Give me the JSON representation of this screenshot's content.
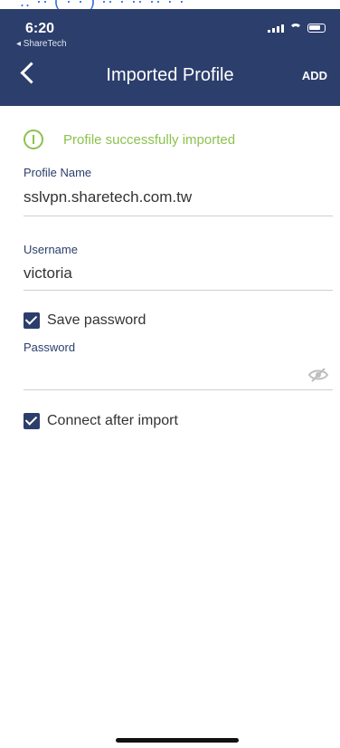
{
  "app": {
    "name": "ShareTech"
  },
  "status_bar": {
    "time": "6:20",
    "back_app": "◂ ShareTech"
  },
  "header": {
    "title": "Imported Profile",
    "action_label": "ADD"
  },
  "banner": {
    "message": "Profile successfully imported"
  },
  "form": {
    "profile_name": {
      "label": "Profile Name",
      "value": "sslvpn.sharetech.com.tw"
    },
    "username": {
      "label": "Username",
      "value": "victoria"
    },
    "save_password": {
      "label": "Save password",
      "checked": true
    },
    "password": {
      "label": "Password",
      "value": ""
    },
    "connect_after_import": {
      "label": "Connect after import",
      "checked": true
    }
  },
  "colors": {
    "header": "#2c3e6c",
    "success": "#8cc24f"
  }
}
